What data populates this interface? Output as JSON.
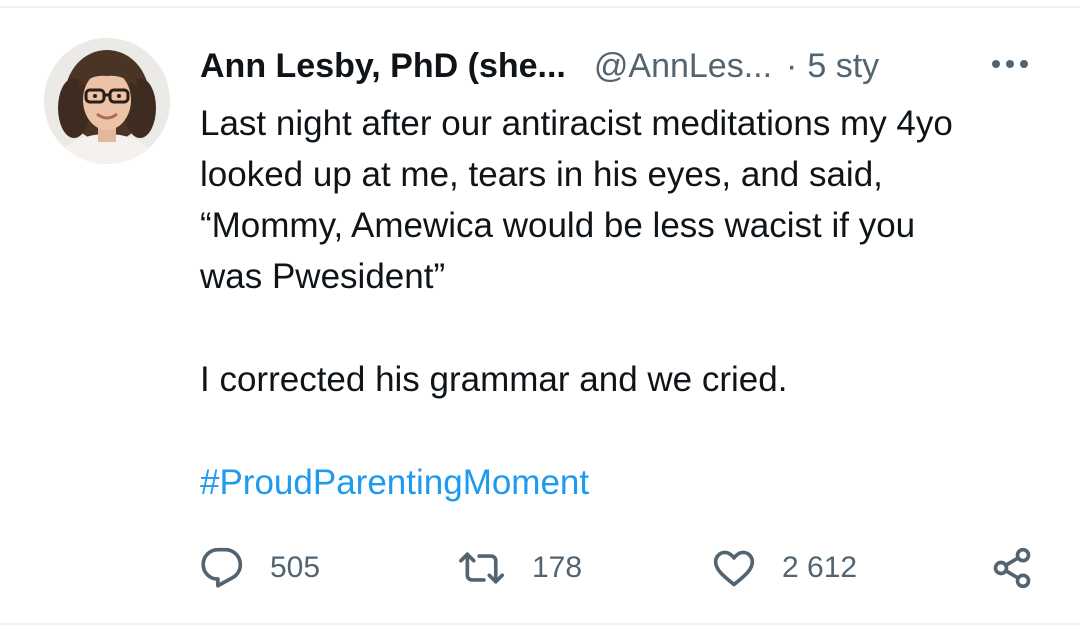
{
  "tweet": {
    "display_name": "Ann Lesby, PhD (she...",
    "handle": "@AnnLes...",
    "separator": "·",
    "time": "5 sty",
    "body": {
      "paragraph1": "Last night after our antiracist meditations my 4yo\nlooked up at me, tears in his eyes, and said,\n“Mommy, Amewica would be less wacist if you\nwas Pwesident”",
      "paragraph2": "I corrected his grammar and we cried.",
      "hashtag": "#ProudParentingMoment"
    },
    "stats": {
      "replies": "505",
      "retweets": "178",
      "likes": "2 612"
    }
  },
  "icons": {
    "more": "more-horizontal-icon",
    "reply": "speech-bubble-icon",
    "retweet": "retweet-icon",
    "like": "heart-icon",
    "share": "share-icon"
  },
  "colors": {
    "text": "#0f1419",
    "secondary": "#536471",
    "hashtag": "#1d9bf0"
  }
}
